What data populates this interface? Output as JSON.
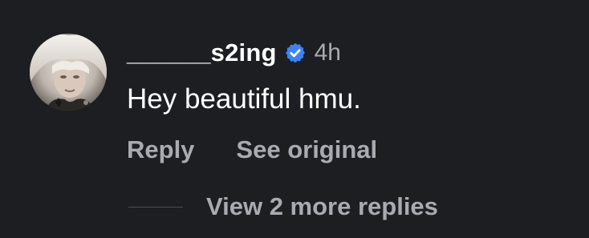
{
  "comment": {
    "author": {
      "username": "______s2ing",
      "verified": true,
      "avatar_icon": "profile-photo"
    },
    "timestamp": "4h",
    "text": "Hey beautiful hmu.",
    "actions": {
      "reply_label": "Reply",
      "see_original_label": "See original"
    },
    "more_replies_label": "View 2 more replies"
  },
  "colors": {
    "background": "#1c1e21",
    "primary_text": "#ffffff",
    "secondary_text": "#a8abb2",
    "verified_badge": "#3b82f6"
  }
}
